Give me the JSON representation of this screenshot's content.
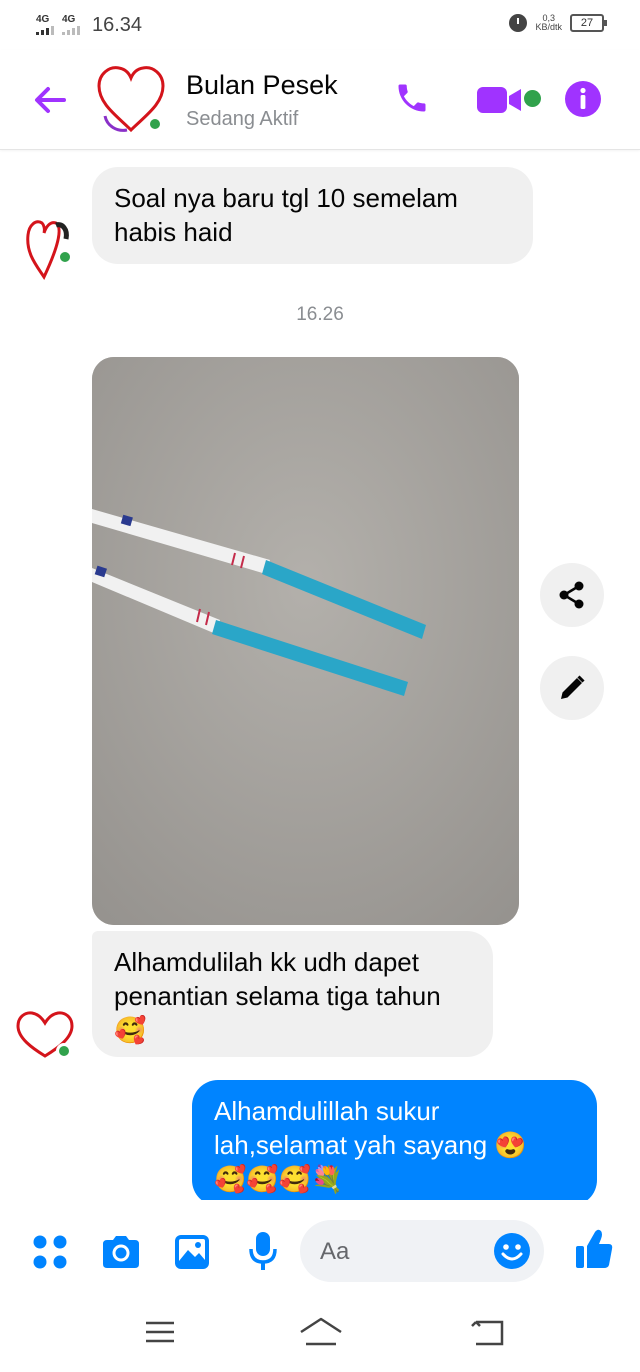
{
  "status_bar": {
    "signal_1": "4G",
    "signal_2": "4G",
    "time": "16.34",
    "net_speed_value": "0,3",
    "net_speed_unit": "KB/dtk",
    "battery": "27"
  },
  "header": {
    "contact_name": "Bulan Pesek",
    "contact_status": "Sedang Aktif"
  },
  "messages": {
    "msg1": {
      "line1": "Soal nya baru tgl 10 semelam",
      "line2": "habis haid"
    },
    "timestamp": "16.26",
    "msg2": {
      "line1": "Alhamdulilah kk udh dapet",
      "line2": "penantian selama tiga tahun",
      "line3": "🥰"
    },
    "msg3": {
      "line1": "Alhamdulillah sukur",
      "line2": "lah,selamat yah sayang 😍",
      "line3": "🥰🥰🥰💐"
    }
  },
  "composer": {
    "placeholder": "Aa"
  },
  "colors": {
    "accent_purple": "#a033ff",
    "messenger_blue": "#0084ff",
    "online_green": "#31a24c",
    "incoming_bubble": "#f0f0f0"
  },
  "icons": [
    "back-arrow-icon",
    "phone-icon",
    "video-camera-icon",
    "info-icon",
    "share-icon",
    "pencil-icon",
    "menu-dots-icon",
    "camera-icon",
    "gallery-icon",
    "microphone-icon",
    "emoji-icon",
    "thumbs-up-icon",
    "recent-apps-icon",
    "home-icon",
    "back-nav-icon"
  ]
}
